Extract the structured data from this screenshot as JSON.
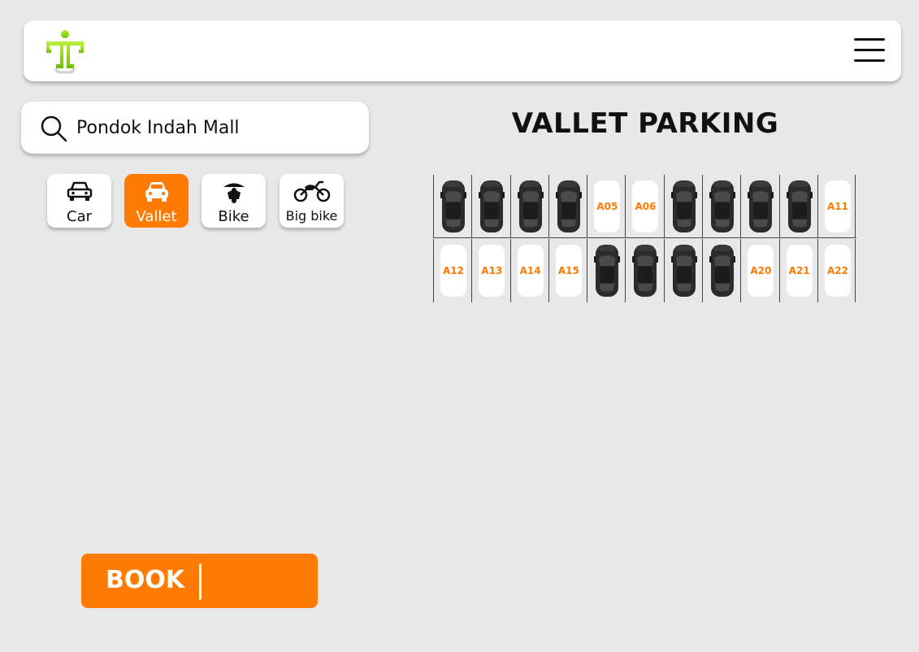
{
  "header": {
    "logo_icon": "figure-logo-icon",
    "menu_icon": "hamburger-menu-icon"
  },
  "search": {
    "value": "Pondok Indah Mall",
    "icon": "search-icon"
  },
  "vehicle_types": [
    {
      "label": "Car",
      "icon": "car-icon",
      "selected": false
    },
    {
      "label": "Vallet",
      "icon": "car-front-icon",
      "selected": true
    },
    {
      "label": "Bike",
      "icon": "scooter-icon",
      "selected": false
    },
    {
      "label": "Big bike",
      "icon": "motorcycle-icon",
      "selected": false
    }
  ],
  "title": "VALLET PARKING",
  "parking": {
    "row1": [
      {
        "id": "A01",
        "occupied": true
      },
      {
        "id": "A02",
        "occupied": true
      },
      {
        "id": "A03",
        "occupied": true
      },
      {
        "id": "A04",
        "occupied": true
      },
      {
        "id": "A05",
        "occupied": false,
        "label": "A05"
      },
      {
        "id": "A06",
        "occupied": false,
        "label": "A06"
      },
      {
        "id": "A07",
        "occupied": true
      },
      {
        "id": "A08",
        "occupied": true
      },
      {
        "id": "A09",
        "occupied": true
      },
      {
        "id": "A10",
        "occupied": true
      },
      {
        "id": "A11",
        "occupied": false,
        "label": "A11"
      }
    ],
    "row2": [
      {
        "id": "A12",
        "occupied": false,
        "label": "A12"
      },
      {
        "id": "A13",
        "occupied": false,
        "label": "A13"
      },
      {
        "id": "A14",
        "occupied": false,
        "label": "A14"
      },
      {
        "id": "A15",
        "occupied": false,
        "label": "A15"
      },
      {
        "id": "A16",
        "occupied": true
      },
      {
        "id": "A17",
        "occupied": true
      },
      {
        "id": "A18",
        "occupied": true
      },
      {
        "id": "A19",
        "occupied": true
      },
      {
        "id": "A20",
        "occupied": false,
        "label": "A20"
      },
      {
        "id": "A21",
        "occupied": false,
        "label": "A21"
      },
      {
        "id": "A22",
        "occupied": false,
        "label": "A22"
      }
    ]
  },
  "book": {
    "label": "BOOK"
  },
  "colors": {
    "accent": "#ff7a00",
    "background": "#e8e8e8",
    "logo": "#8fd400"
  }
}
